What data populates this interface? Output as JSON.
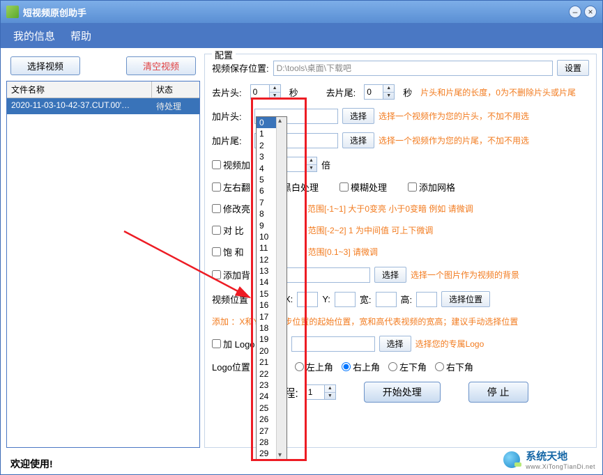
{
  "window": {
    "title": "短视频原创助手"
  },
  "menu": {
    "info": "我的信息",
    "help": "帮助"
  },
  "left": {
    "select_video": "选择视频",
    "clear_video": "清空视频",
    "col_filename": "文件名称",
    "col_status": "状态",
    "row1_name": "2020-11-03-10-42-37.CUT.00'…",
    "row1_status": "待处理"
  },
  "config": {
    "legend": "配置",
    "save_label": "视频保存位置:",
    "save_path": "D:\\tools\\桌面\\下载吧",
    "set_btn": "设置",
    "trim_head": "去片头:",
    "trim_head_val": "0",
    "sec": "秒",
    "trim_tail": "去片尾:",
    "trim_tail_val": "0",
    "trim_hint": "片头和片尾的长度，0为不删除片头或片尾",
    "add_head": "加片头:",
    "select_btn": "选择",
    "add_head_hint": "选择一个视频作为您的片头，不加不用选",
    "add_tail": "加片尾:",
    "add_tail_hint": "选择一个视频作为您的片尾，不加不用选",
    "speed": "视频加",
    "times": "倍",
    "flip": "左右翻",
    "bw": "黑白处理",
    "blur": "模糊处理",
    "grid": "添加网格",
    "brightness": "修改亮",
    "brightness_hint": "范围[-1~1]   大于0变亮 小于0变暗   例如 请微调",
    "contrast": "对 比",
    "contrast_hint": "范围[-2~2]   1 为中间值  可上下微调",
    "saturation": "饱  和",
    "saturation_hint": "范围[0.1~3]   请微调",
    "add_bg": "添加背",
    "bg_hint": "选择一个图片作为视频的背景",
    "pos_label": "视频位置",
    "x": "X:",
    "y": "Y:",
    "w": "宽:",
    "h": "高:",
    "pos_btn": "选择位置",
    "pos_hint": "添加                    ：X和Y代表初步位置的起始位置，宽和高代表视频的宽高；建议手动选择位置",
    "add_logo": "加 Logo",
    "logo_hint": "选择您的专属Logo",
    "logo_pos": "Logo位置",
    "tl": "左上角",
    "tr": "右上角",
    "bl": "左下角",
    "br": "右下角",
    "threads": "线程:",
    "threads_val": "1",
    "start": "开始处理",
    "stop": "停    止"
  },
  "dropdown": {
    "items": [
      "0",
      "1",
      "2",
      "3",
      "4",
      "5",
      "6",
      "7",
      "8",
      "9",
      "10",
      "11",
      "12",
      "13",
      "14",
      "15",
      "16",
      "17",
      "18",
      "19",
      "20",
      "21",
      "22",
      "23",
      "24",
      "25",
      "26",
      "27",
      "28",
      "29"
    ],
    "selected": "0"
  },
  "status": {
    "welcome": "欢迎使用!"
  },
  "watermark": {
    "main": "系统天地",
    "sub": "www.XiTongTianDi.net"
  }
}
